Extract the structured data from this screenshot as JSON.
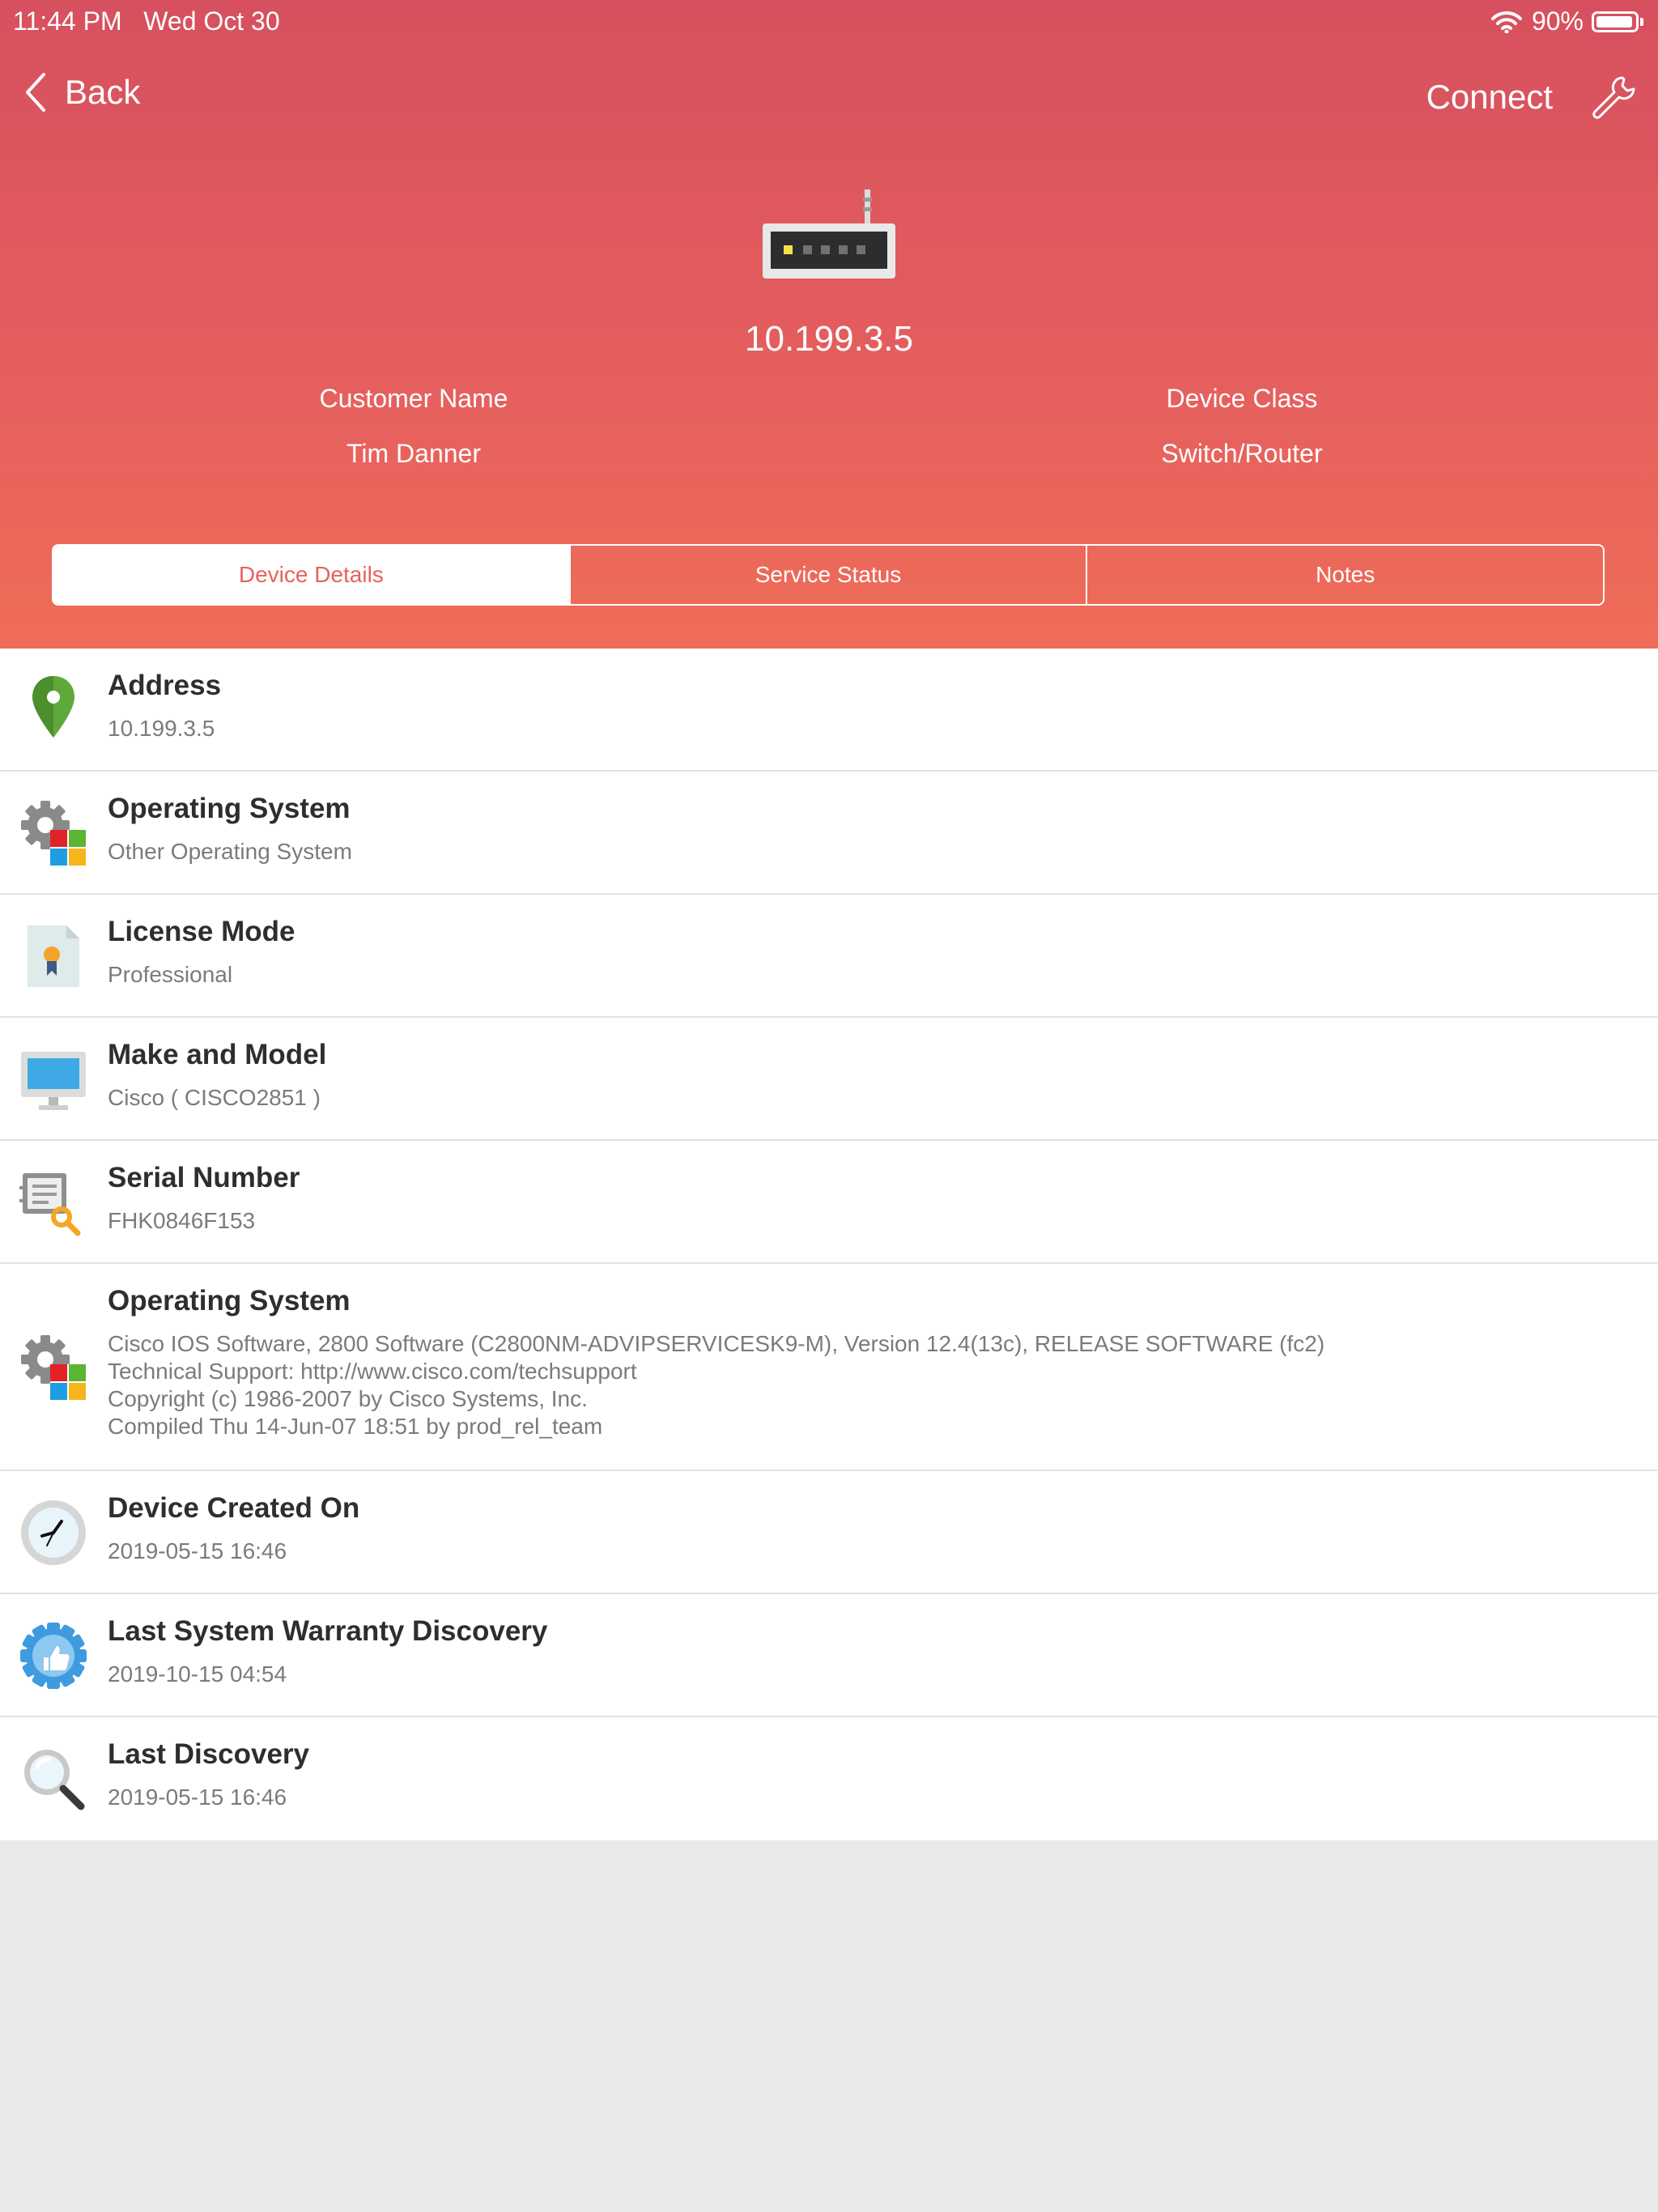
{
  "status_bar": {
    "time": "11:44 PM",
    "date": "Wed Oct 30",
    "battery": "90%",
    "wifi_icon": "wifi-icon",
    "battery_icon": "battery-icon"
  },
  "nav": {
    "back_label": "Back",
    "connect_label": "Connect",
    "wrench_icon": "wrench-icon"
  },
  "device": {
    "icon": "router-icon",
    "ip": "10.199.3.5",
    "customer_label": "Customer Name",
    "customer_value": "Tim Danner",
    "class_label": "Device Class",
    "class_value": "Switch/Router"
  },
  "tabs": [
    {
      "label": "Device Details",
      "active": true
    },
    {
      "label": "Service Status",
      "active": false
    },
    {
      "label": "Notes",
      "active": false
    }
  ],
  "details": [
    {
      "icon": "map-pin-icon",
      "title": "Address",
      "value": "10.199.3.5"
    },
    {
      "icon": "os-gear-icon",
      "title": "Operating System",
      "value": "Other Operating System"
    },
    {
      "icon": "license-certificate-icon",
      "title": "License Mode",
      "value": "Professional"
    },
    {
      "icon": "monitor-icon",
      "title": "Make and Model",
      "value": "Cisco ( CISCO2851 )"
    },
    {
      "icon": "serial-search-icon",
      "title": "Serial Number",
      "value": "FHK0846F153"
    },
    {
      "icon": "os-gear-icon",
      "title": "Operating System",
      "value": "Cisco IOS Software, 2800 Software (C2800NM-ADVIPSERVICESK9-M), Version 12.4(13c), RELEASE SOFTWARE (fc2)\nTechnical Support: http://www.cisco.com/techsupport\nCopyright (c) 1986-2007 by Cisco Systems, Inc.\nCompiled Thu 14-Jun-07 18:51 by prod_rel_team"
    },
    {
      "icon": "clock-icon",
      "title": "Device Created On",
      "value": "2019-05-15 16:46"
    },
    {
      "icon": "warranty-badge-icon",
      "title": "Last System Warranty Discovery",
      "value": "2019-10-15 04:54"
    },
    {
      "icon": "magnifier-icon",
      "title": "Last Discovery",
      "value": "2019-05-15 16:46"
    }
  ],
  "colors": {
    "header_top": "#d6505f",
    "header_bottom": "#ef6d58",
    "tab_active_text": "#e8625d",
    "background": "#e9eaec"
  }
}
